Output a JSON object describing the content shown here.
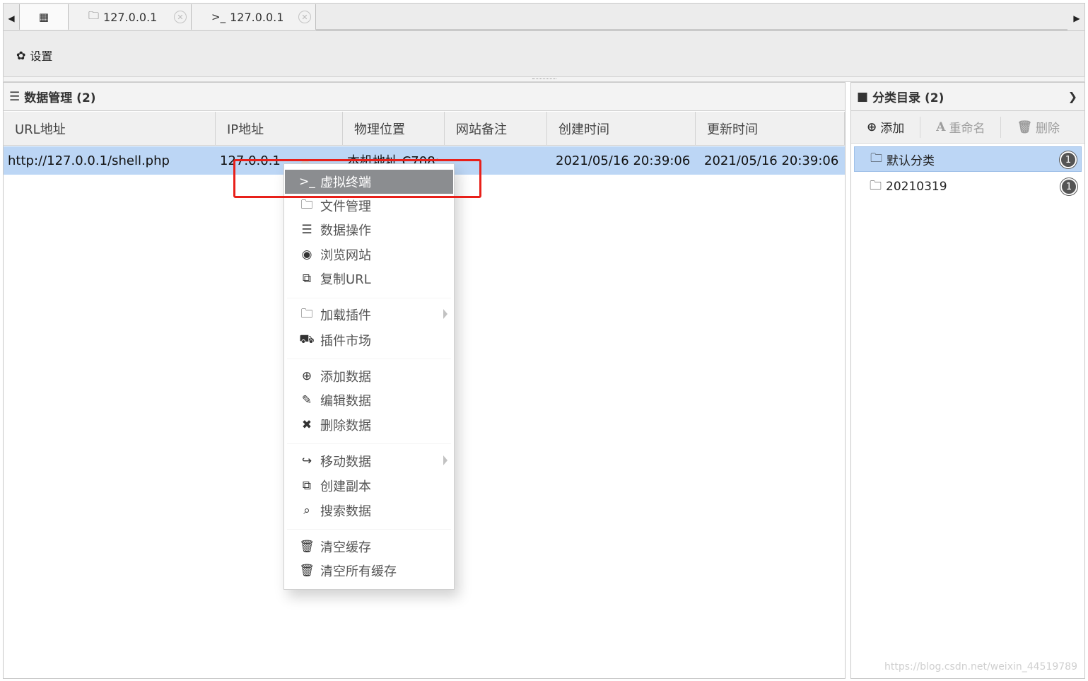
{
  "tabs": {
    "scroll_left": "◀",
    "scroll_right": "▶",
    "home_icon": "grid-icon",
    "items": [
      {
        "icon": "folder-icon",
        "label": "127.0.0.1"
      },
      {
        "icon": "terminal-icon",
        "label": "127.0.0.1"
      }
    ]
  },
  "toolbar": {
    "settings_label": "设置"
  },
  "data_panel": {
    "title": "数据管理 (2)",
    "columns": [
      "URL地址",
      "IP地址",
      "物理位置",
      "网站备注",
      "创建时间",
      "更新时间"
    ],
    "rows": [
      {
        "url": "http://127.0.0.1/shell.php",
        "ip": "127.0.0.1",
        "location": "本机地址 C708:",
        "note": "",
        "created": "2021/05/16 20:39:06",
        "updated": "2021/05/16 20:39:06"
      }
    ]
  },
  "category_panel": {
    "title": "分类目录 (2)",
    "buttons": {
      "add": "添加",
      "rename": "重命名",
      "delete": "删除"
    },
    "items": [
      {
        "name": "默认分类",
        "count": "1",
        "selected": true
      },
      {
        "name": "20210319",
        "count": "1",
        "selected": false
      }
    ]
  },
  "context_menu": {
    "items": [
      {
        "label": "虚拟终端",
        "icon": "terminal-icon",
        "active": true
      },
      {
        "label": "文件管理",
        "icon": "folder-icon"
      },
      {
        "label": "数据操作",
        "icon": "database-icon"
      },
      {
        "label": "浏览网站",
        "icon": "chrome-icon"
      },
      {
        "label": "复制URL",
        "icon": "copy-icon"
      },
      {
        "label": "加载插件",
        "icon": "folder-icon",
        "submenu": true
      },
      {
        "label": "插件市场",
        "icon": "cart-icon"
      },
      {
        "label": "添加数据",
        "icon": "plus-circle-icon"
      },
      {
        "label": "编辑数据",
        "icon": "edit-icon"
      },
      {
        "label": "删除数据",
        "icon": "close-icon"
      },
      {
        "label": "移动数据",
        "icon": "share-icon",
        "submenu": true
      },
      {
        "label": "创建副本",
        "icon": "copy-icon"
      },
      {
        "label": "搜索数据",
        "icon": "search-icon"
      },
      {
        "label": "清空缓存",
        "icon": "trash-outline-icon"
      },
      {
        "label": "清空所有缓存",
        "icon": "trash-icon"
      }
    ]
  },
  "watermark": "https://blog.csdn.net/weixin_44519789",
  "colors": {
    "selection": "#bcd6f5",
    "menu_active": "#8b8d90",
    "highlight_box": "#e8201a"
  }
}
